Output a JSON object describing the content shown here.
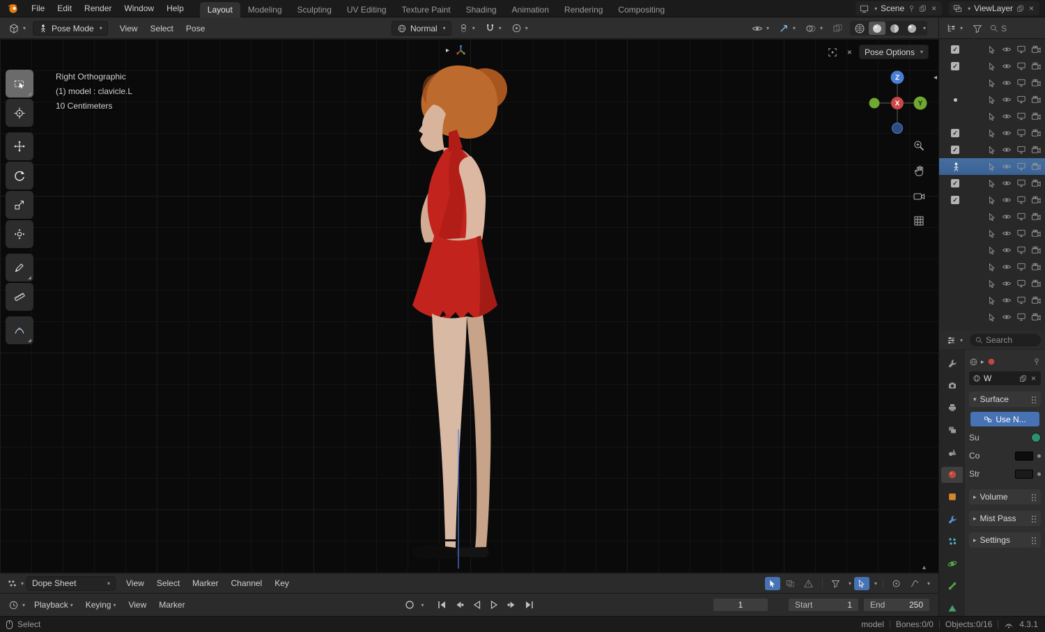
{
  "colors": {
    "accent": "#4772b3",
    "selection": "#3a6195",
    "dress": "#c2231d",
    "hair": "#bc6a2e",
    "skin": "#d8b5a0"
  },
  "topbar": {
    "menus": [
      "File",
      "Edit",
      "Render",
      "Window",
      "Help"
    ],
    "workspaces": [
      "Layout",
      "Modeling",
      "Sculpting",
      "UV Editing",
      "Texture Paint",
      "Shading",
      "Animation",
      "Rendering",
      "Compositing"
    ],
    "active_workspace": "Layout",
    "scene_label": "Scene",
    "viewlayer_label": "ViewLayer"
  },
  "viewport_header": {
    "mode": "Pose Mode",
    "menus": [
      "View",
      "Select",
      "Pose"
    ],
    "orientation": "Normal"
  },
  "viewport": {
    "overlay_lines": [
      "Right Orthographic",
      "(1) model : clavicle.L",
      "10 Centimeters"
    ],
    "pose_options_label": "Pose Options",
    "gizmo": {
      "x": "X",
      "y": "Y",
      "z": "Z"
    }
  },
  "toolbar": {
    "active": "box-select",
    "tools": [
      {
        "name": "box-select",
        "corner": true
      },
      {
        "name": "cursor"
      },
      {
        "name": "move",
        "gap": true
      },
      {
        "name": "rotate"
      },
      {
        "name": "scale"
      },
      {
        "name": "transform"
      },
      {
        "name": "annotate",
        "gap": true,
        "corner": true
      },
      {
        "name": "measure"
      },
      {
        "name": "pose-breakdowner",
        "gap": true,
        "corner": true
      }
    ]
  },
  "outliner": {
    "search_text": "S",
    "rows": [
      {
        "cb": "check"
      },
      {
        "cb": "check"
      },
      {
        "cb": "none"
      },
      {
        "cb": "dot"
      },
      {
        "cb": "none"
      },
      {
        "cb": "check"
      },
      {
        "cb": "check"
      },
      {
        "cb": "none",
        "sel": true,
        "person": true
      },
      {
        "cb": "check"
      },
      {
        "cb": "check"
      },
      {
        "cb": "none"
      },
      {
        "cb": "none"
      },
      {
        "cb": "none"
      },
      {
        "cb": "none"
      },
      {
        "cb": "none"
      },
      {
        "cb": "none"
      },
      {
        "cb": "none"
      }
    ]
  },
  "properties": {
    "search_placeholder": "Search",
    "world_name": "W",
    "use_nodes_label": "Use N...",
    "fields": {
      "surface_short": "Su",
      "color_short": "Co",
      "strength_short": "Str"
    },
    "sections": {
      "surface": "Surface",
      "volume": "Volume",
      "mist": "Mist Pass",
      "settings": "Settings"
    },
    "tabs": [
      {
        "name": "tool",
        "shape": "wrench",
        "color": "#9a9a9a"
      },
      {
        "name": "render",
        "shape": "camera",
        "color": "#9a9a9a"
      },
      {
        "name": "output",
        "shape": "printer",
        "color": "#9a9a9a"
      },
      {
        "name": "view-layer",
        "shape": "layers",
        "color": "#9a9a9a"
      },
      {
        "name": "scene",
        "shape": "scene",
        "color": "#9a9a9a"
      },
      {
        "name": "world",
        "shape": "sphere",
        "color": "#c4473d",
        "selected": true
      },
      {
        "name": "object",
        "shape": "square",
        "color": "#d8862c"
      },
      {
        "name": "modifiers",
        "shape": "wrench",
        "color": "#5a8fd0"
      },
      {
        "name": "particles",
        "shape": "dots",
        "color": "#4aa8c8"
      },
      {
        "name": "physics",
        "shape": "orbit",
        "color": "#57a64a"
      },
      {
        "name": "constraints",
        "shape": "bone",
        "color": "#57a64a"
      },
      {
        "name": "object-data",
        "shape": "triangle",
        "color": "#4a9e6e"
      }
    ]
  },
  "dope_sheet": {
    "editor_label": "Dope Sheet",
    "menus": [
      "View",
      "Select",
      "Marker",
      "Channel",
      "Key"
    ]
  },
  "timeline": {
    "playback_label": "Playback",
    "keying_label": "Keying",
    "menus": [
      "View",
      "Marker"
    ],
    "current_frame": "1",
    "start_label": "Start",
    "start_value": "1",
    "end_label": "End",
    "end_value": "250"
  },
  "statusbar": {
    "left_label": "Select",
    "items": [
      "model",
      "Bones:0/0",
      "Objects:0/16"
    ],
    "version": "4.3.1"
  }
}
